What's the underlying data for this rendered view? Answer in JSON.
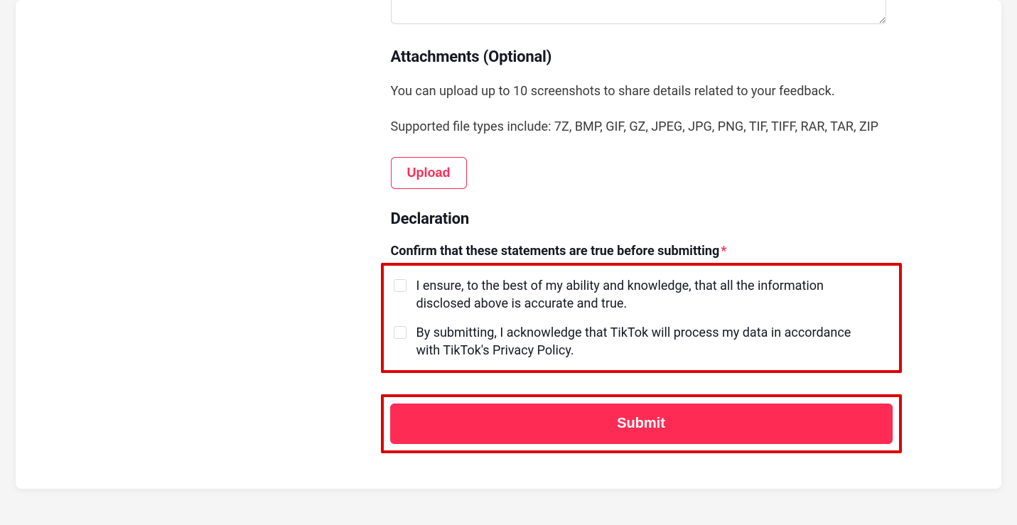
{
  "attachments": {
    "heading": "Attachments (Optional)",
    "help1": "You can upload up to 10 screenshots to share details related to your feedback.",
    "help2": "Supported file types include: 7Z, BMP, GIF, GZ, JPEG, JPG, PNG, TIF, TIFF, RAR, TAR, ZIP",
    "uploadLabel": "Upload"
  },
  "declaration": {
    "heading": "Declaration",
    "confirmLabel": "Confirm that these statements are true before submitting",
    "requiredMark": "*",
    "statements": [
      "I ensure, to the best of my ability and knowledge, that all the information disclosed above is accurate and true.",
      "By submitting, I acknowledge that TikTok will process my data in accordance with TikTok's Privacy Policy."
    ]
  },
  "submitLabel": "Submit"
}
